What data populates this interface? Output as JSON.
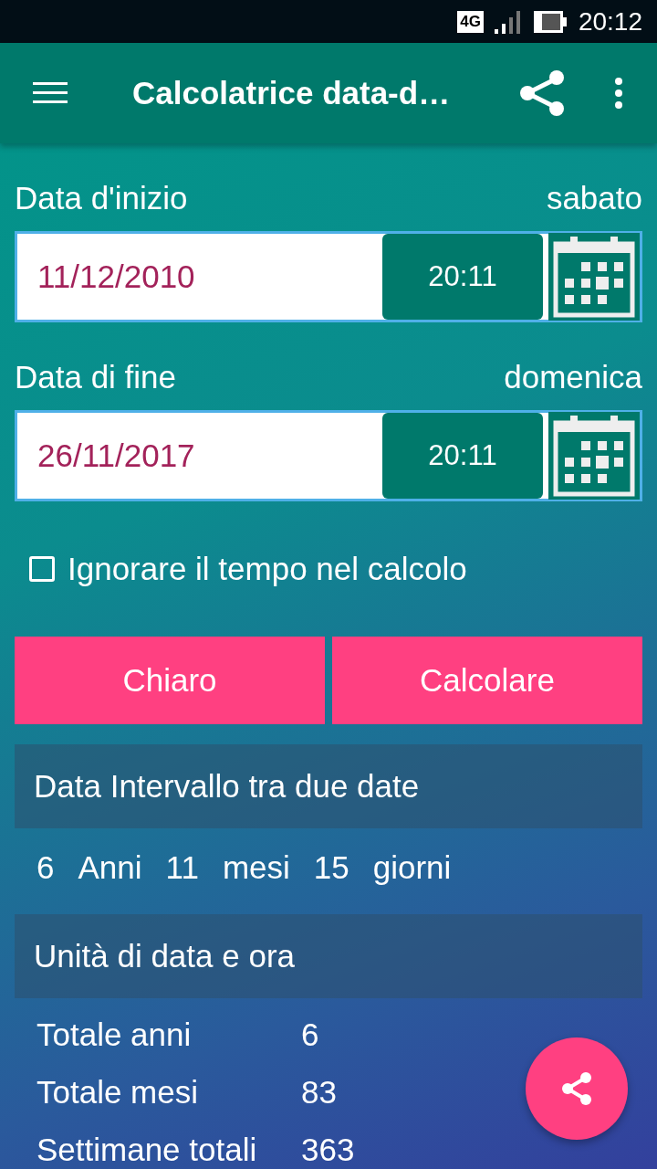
{
  "status_bar": {
    "network": "4G",
    "time": "20:12"
  },
  "app_bar": {
    "title": "Calcolatrice data-d…"
  },
  "start": {
    "label": "Data d'inizio",
    "weekday": "sabato",
    "date": "11/12/2010",
    "time": "20:11"
  },
  "end": {
    "label": "Data di fine",
    "weekday": "domenica",
    "date": "26/11/2017",
    "time": "20:11"
  },
  "ignore_time": {
    "label": "Ignorare il tempo nel calcolo",
    "checked": false
  },
  "buttons": [
    "Chiaro",
    "Calcolare"
  ],
  "interval": {
    "title": "Data Intervallo tra due date",
    "parts": [
      "6",
      "Anni",
      "11",
      "mesi",
      "15",
      "giorni"
    ]
  },
  "units": {
    "title": "Unità di data e ora",
    "rows": [
      {
        "label": "Totale anni",
        "value": "6"
      },
      {
        "label": "Totale mesi",
        "value": "83"
      },
      {
        "label": "Settimane totali",
        "value": "363"
      }
    ]
  }
}
